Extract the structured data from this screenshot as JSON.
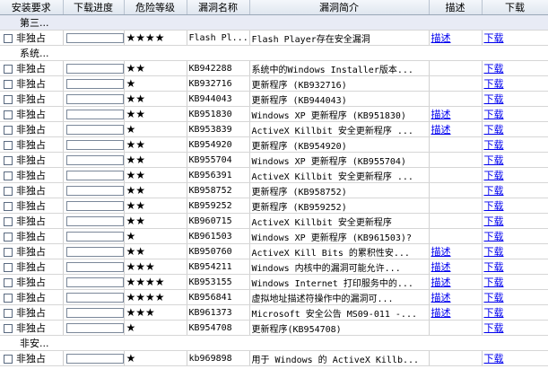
{
  "columns": [
    "安装要求",
    "下载进度",
    "危险等级",
    "漏洞名称",
    "漏洞简介",
    "描述",
    "下载"
  ],
  "rows": [
    {
      "type": "group",
      "label": "第三..."
    },
    {
      "type": "item",
      "install": "非独占",
      "stars": "★★★★",
      "name": "Flash Pl...",
      "desc": "Flash Player存在安全漏洞",
      "detail": "描述",
      "download": "下载"
    },
    {
      "type": "sub",
      "label": "系统..."
    },
    {
      "type": "item",
      "install": "非独占",
      "stars": "★★",
      "name": "KB942288",
      "desc": "系统中的Windows Installer版本...",
      "detail": "",
      "download": "下载"
    },
    {
      "type": "item",
      "install": "非独占",
      "stars": "★",
      "name": "KB932716",
      "desc": "更新程序 (KB932716)",
      "detail": "",
      "download": "下载"
    },
    {
      "type": "item",
      "install": "非独占",
      "stars": "★★",
      "name": "KB944043",
      "desc": "更新程序 (KB944043)",
      "detail": "",
      "download": "下载"
    },
    {
      "type": "item",
      "install": "非独占",
      "stars": "★★",
      "name": "KB951830",
      "desc": "Windows XP 更新程序 (KB951830)",
      "detail": "描述",
      "download": "下载"
    },
    {
      "type": "item",
      "install": "非独占",
      "stars": "★",
      "name": "KB953839",
      "desc": "ActiveX Killbit 安全更新程序 ...",
      "detail": "描述",
      "download": "下载"
    },
    {
      "type": "item",
      "install": "非独占",
      "stars": "★★",
      "name": "KB954920",
      "desc": "更新程序 (KB954920)",
      "detail": "",
      "download": "下载"
    },
    {
      "type": "item",
      "install": "非独占",
      "stars": "★★",
      "name": "KB955704",
      "desc": "Windows XP 更新程序 (KB955704)",
      "detail": "",
      "download": "下载"
    },
    {
      "type": "item",
      "install": "非独占",
      "stars": "★★",
      "name": "KB956391",
      "desc": "ActiveX Killbit 安全更新程序 ...",
      "detail": "",
      "download": "下载"
    },
    {
      "type": "item",
      "install": "非独占",
      "stars": "★★",
      "name": "KB958752",
      "desc": "更新程序 (KB958752)",
      "detail": "",
      "download": "下载"
    },
    {
      "type": "item",
      "install": "非独占",
      "stars": "★★",
      "name": "KB959252",
      "desc": "更新程序 (KB959252)",
      "detail": "",
      "download": "下载"
    },
    {
      "type": "item",
      "install": "非独占",
      "stars": "★★",
      "name": "KB960715",
      "desc": "ActiveX Killbit 安全更新程序",
      "detail": "",
      "download": "下载"
    },
    {
      "type": "item",
      "install": "非独占",
      "stars": "★",
      "name": "KB961503",
      "desc": "Windows XP 更新程序 (KB961503)?",
      "detail": "",
      "download": "下载"
    },
    {
      "type": "item",
      "install": "非独占",
      "stars": "★★",
      "name": "KB950760",
      "desc": "ActiveX Kill Bits 的累积性安...",
      "detail": "描述",
      "download": "下载"
    },
    {
      "type": "item",
      "install": "非独占",
      "stars": "★★★",
      "name": "KB954211",
      "desc": "Windows 内核中的漏洞可能允许...",
      "detail": "描述",
      "download": "下载"
    },
    {
      "type": "item",
      "install": "非独占",
      "stars": "★★★★",
      "name": "KB953155",
      "desc": "Windows Internet 打印服务中的...",
      "detail": "描述",
      "download": "下载"
    },
    {
      "type": "item",
      "install": "非独占",
      "stars": "★★★★",
      "name": "KB956841",
      "desc": "虚拟地址描述符操作中的漏洞可...",
      "detail": "描述",
      "download": "下载"
    },
    {
      "type": "item",
      "install": "非独占",
      "stars": "★★★",
      "name": "KB961373",
      "desc": "Microsoft 安全公告 MS09-011 -...",
      "detail": "描述",
      "download": "下载"
    },
    {
      "type": "item",
      "install": "非独占",
      "stars": "★",
      "name": "KB954708",
      "desc": "更新程序(KB954708)",
      "detail": "",
      "download": "下载"
    },
    {
      "type": "sub",
      "label": "非安..."
    },
    {
      "type": "item",
      "install": "非独占",
      "stars": "★",
      "name": "kb969898",
      "desc": "用于 Windows 的 ActiveX Killb...",
      "detail": "",
      "download": "下载"
    }
  ]
}
